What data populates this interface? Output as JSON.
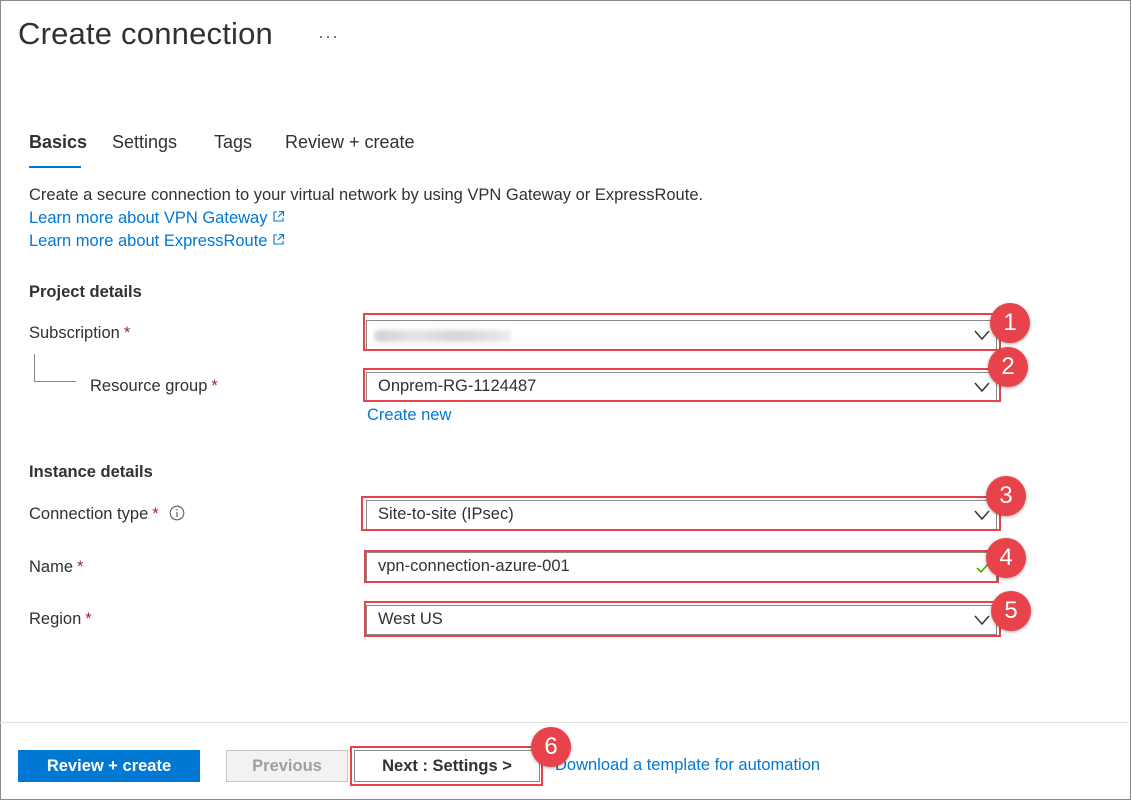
{
  "page": {
    "title": "Create connection",
    "more_label": "···"
  },
  "tabs": [
    {
      "label": "Basics",
      "active": true
    },
    {
      "label": "Settings",
      "active": false
    },
    {
      "label": "Tags",
      "active": false
    },
    {
      "label": "Review + create",
      "active": false
    }
  ],
  "intro": {
    "description": "Create a secure connection to your virtual network by using VPN Gateway or ExpressRoute.",
    "link_vpn": "Learn more about VPN Gateway",
    "link_expressroute": "Learn more about ExpressRoute"
  },
  "project_details": {
    "heading": "Project details",
    "subscription_label": "Subscription",
    "subscription_value": "",
    "resource_group_label": "Resource group",
    "resource_group_value": "Onprem-RG-1124487",
    "create_new_label": "Create new"
  },
  "instance_details": {
    "heading": "Instance details",
    "connection_type_label": "Connection type",
    "connection_type_value": "Site-to-site (IPsec)",
    "name_label": "Name",
    "name_value": "vpn-connection-azure-001",
    "region_label": "Region",
    "region_value": "West US"
  },
  "required_marker": "*",
  "callouts": [
    "1",
    "2",
    "3",
    "4",
    "5",
    "6"
  ],
  "footer": {
    "review_create": "Review + create",
    "previous": "Previous",
    "next_settings": "Next : Settings >",
    "download_template": "Download a template for automation"
  },
  "colors": {
    "accent": "#0078d4",
    "callout": "#e8424a",
    "required": "#a4262c",
    "valid_check": "#57a300"
  },
  "icons": {
    "external_link": "external-link-icon",
    "info": "info-icon",
    "dropdown": "chevron-down-icon",
    "valid": "checkmark-icon"
  }
}
